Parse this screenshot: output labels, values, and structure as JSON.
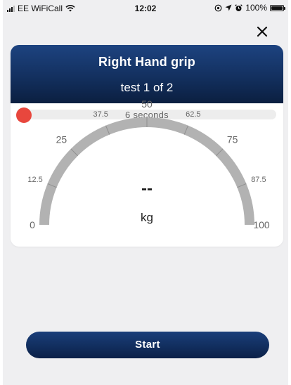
{
  "status_bar": {
    "carrier": "EE WiFiCall",
    "time": "12:02",
    "battery": "100%",
    "battery_level": 1.0,
    "icons": [
      "signal-icon",
      "wifi-icon",
      "location-icon",
      "alarm-icon",
      "battery-icon"
    ]
  },
  "header": {
    "close_icon": "close-icon"
  },
  "card": {
    "title": "Right Hand grip",
    "subtitle": "test 1 of 2"
  },
  "timer": {
    "label": "6 seconds",
    "dot_color": "#e8473d"
  },
  "gauge": {
    "min": 0,
    "max": 100,
    "ticks": [
      "0",
      "12.5",
      "25",
      "37.5",
      "50",
      "62.5",
      "75",
      "87.5",
      "100"
    ],
    "value_text": "--",
    "unit": "kg"
  },
  "actions": {
    "start_label": "Start"
  },
  "colors": {
    "accent_dark": "#0b1f40",
    "accent": "#1d4380",
    "gauge_track": "#b2b2b2",
    "background": "#efeff1"
  }
}
